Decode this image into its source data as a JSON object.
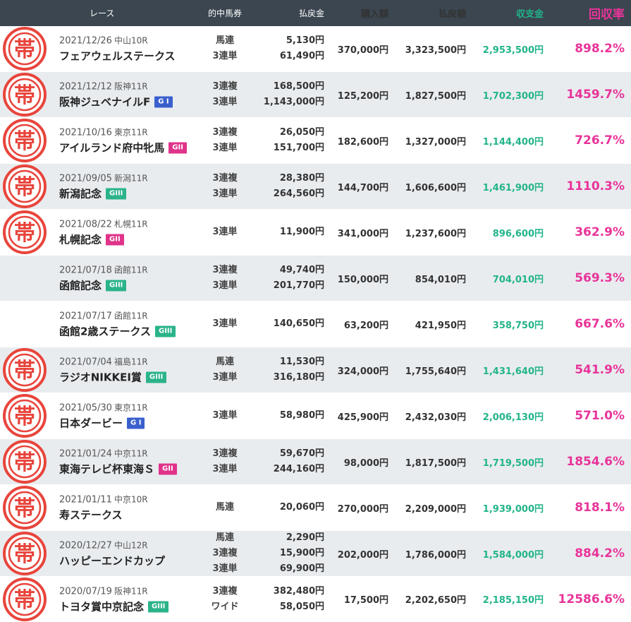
{
  "header": {
    "race": "レース",
    "ticket": "的中馬券",
    "payout": "払戻金",
    "buy": "購入額",
    "return": "払戻額",
    "profit": "収支金",
    "rate": "回収率"
  },
  "mark": {
    "glyph": "帯",
    "color": "#e8453c",
    "icon": "obi-stamp-icon"
  },
  "rows": [
    {
      "date": "2021/12/26",
      "venue": "中山10R",
      "name": "フェアウェルステークス",
      "grade": "",
      "grade_color": "",
      "mark": true,
      "alt": false,
      "tickets": [
        [
          "馬連",
          "5,130円"
        ],
        [
          "3連単",
          "61,490円"
        ]
      ],
      "buy": "370,000円",
      "return": "3,323,500円",
      "profit": "2,953,500円",
      "rate": "898.2%"
    },
    {
      "date": "2021/12/12",
      "venue": "阪神11R",
      "name": "阪神ジュベナイルF",
      "grade": "G I",
      "grade_color": "blue",
      "mark": true,
      "alt": true,
      "tickets": [
        [
          "3連複",
          "168,500円"
        ],
        [
          "3連単",
          "1,143,000円"
        ]
      ],
      "buy": "125,200円",
      "return": "1,827,500円",
      "profit": "1,702,300円",
      "rate": "1459.7%"
    },
    {
      "date": "2021/10/16",
      "venue": "東京11R",
      "name": "アイルランド府中牝馬",
      "grade": "GII",
      "grade_color": "pink",
      "mark": true,
      "alt": false,
      "tickets": [
        [
          "3連複",
          "26,050円"
        ],
        [
          "3連単",
          "151,700円"
        ]
      ],
      "buy": "182,600円",
      "return": "1,327,000円",
      "profit": "1,144,400円",
      "rate": "726.7%"
    },
    {
      "date": "2021/09/05",
      "venue": "新潟11R",
      "name": "新潟記念",
      "grade": "GIII",
      "grade_color": "green",
      "mark": true,
      "alt": true,
      "tickets": [
        [
          "3連複",
          "28,380円"
        ],
        [
          "3連単",
          "264,560円"
        ]
      ],
      "buy": "144,700円",
      "return": "1,606,600円",
      "profit": "1,461,900円",
      "rate": "1110.3%"
    },
    {
      "date": "2021/08/22",
      "venue": "札幌11R",
      "name": "札幌記念",
      "grade": "GII",
      "grade_color": "pink",
      "mark": true,
      "alt": false,
      "tickets": [
        [
          "3連単",
          "11,900円"
        ]
      ],
      "buy": "341,000円",
      "return": "1,237,600円",
      "profit": "896,600円",
      "rate": "362.9%"
    },
    {
      "date": "2021/07/18",
      "venue": "函館11R",
      "name": "函館記念",
      "grade": "GIII",
      "grade_color": "green",
      "mark": false,
      "alt": true,
      "tickets": [
        [
          "3連複",
          "49,740円"
        ],
        [
          "3連単",
          "201,770円"
        ]
      ],
      "buy": "150,000円",
      "return": "854,010円",
      "profit": "704,010円",
      "rate": "569.3%"
    },
    {
      "date": "2021/07/17",
      "venue": "函館11R",
      "name": "函館2歳ステークス",
      "grade": "GIII",
      "grade_color": "green",
      "mark": false,
      "alt": false,
      "tickets": [
        [
          "3連単",
          "140,650円"
        ]
      ],
      "buy": "63,200円",
      "return": "421,950円",
      "profit": "358,750円",
      "rate": "667.6%"
    },
    {
      "date": "2021/07/04",
      "venue": "福島11R",
      "name": "ラジオNIKKEI賞",
      "grade": "GIII",
      "grade_color": "green",
      "mark": true,
      "alt": true,
      "tickets": [
        [
          "馬連",
          "11,530円"
        ],
        [
          "3連単",
          "316,180円"
        ]
      ],
      "buy": "324,000円",
      "return": "1,755,640円",
      "profit": "1,431,640円",
      "rate": "541.9%"
    },
    {
      "date": "2021/05/30",
      "venue": "東京11R",
      "name": "日本ダービー",
      "grade": "G I",
      "grade_color": "blue",
      "mark": true,
      "alt": false,
      "tickets": [
        [
          "3連単",
          "58,980円"
        ]
      ],
      "buy": "425,900円",
      "return": "2,432,030円",
      "profit": "2,006,130円",
      "rate": "571.0%"
    },
    {
      "date": "2021/01/24",
      "venue": "中京11R",
      "name": "東海テレビ杯東海Ｓ",
      "grade": "GII",
      "grade_color": "pink",
      "mark": true,
      "alt": true,
      "tickets": [
        [
          "3連複",
          "59,670円"
        ],
        [
          "3連単",
          "244,160円"
        ]
      ],
      "buy": "98,000円",
      "return": "1,817,500円",
      "profit": "1,719,500円",
      "rate": "1854.6%"
    },
    {
      "date": "2021/01/11",
      "venue": "中京10R",
      "name": "寿ステークス",
      "grade": "",
      "grade_color": "",
      "mark": true,
      "alt": false,
      "tickets": [
        [
          "馬連",
          "20,060円"
        ]
      ],
      "buy": "270,000円",
      "return": "2,209,000円",
      "profit": "1,939,000円",
      "rate": "818.1%"
    },
    {
      "date": "2020/12/27",
      "venue": "中山12R",
      "name": "ハッピーエンドカップ",
      "grade": "",
      "grade_color": "",
      "mark": true,
      "alt": true,
      "tickets": [
        [
          "馬連",
          "2,290円"
        ],
        [
          "3連複",
          "15,900円"
        ],
        [
          "3連単",
          "69,900円"
        ]
      ],
      "buy": "202,000円",
      "return": "1,786,000円",
      "profit": "1,584,000円",
      "rate": "884.2%"
    },
    {
      "date": "2020/07/19",
      "venue": "阪神11R",
      "name": "トヨタ賞中京記念",
      "grade": "GIII",
      "grade_color": "green",
      "mark": true,
      "alt": false,
      "tickets": [
        [
          "3連複",
          "382,480円"
        ],
        [
          "ワイド",
          "58,050円"
        ]
      ],
      "buy": "17,500円",
      "return": "2,202,650円",
      "profit": "2,185,150円",
      "rate": "12586.6%"
    }
  ]
}
